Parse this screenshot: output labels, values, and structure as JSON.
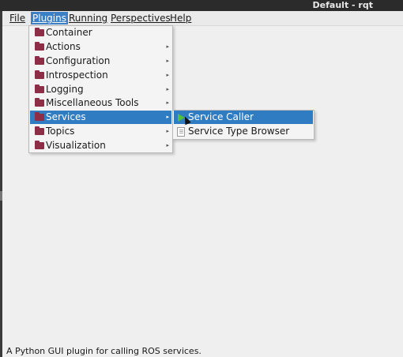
{
  "window": {
    "title": "Default - rqt"
  },
  "menubar": {
    "items": [
      {
        "label": "File"
      },
      {
        "label": "Plugins",
        "active": true
      },
      {
        "label": "Running"
      },
      {
        "label": "Perspectives"
      },
      {
        "label": "Help"
      }
    ]
  },
  "plugins_menu": {
    "items": [
      {
        "label": "Container",
        "has_submenu": false
      },
      {
        "label": "Actions",
        "has_submenu": true
      },
      {
        "label": "Configuration",
        "has_submenu": true
      },
      {
        "label": "Introspection",
        "has_submenu": true
      },
      {
        "label": "Logging",
        "has_submenu": true
      },
      {
        "label": "Miscellaneous Tools",
        "has_submenu": true
      },
      {
        "label": "Services",
        "has_submenu": true,
        "active": true
      },
      {
        "label": "Topics",
        "has_submenu": true
      },
      {
        "label": "Visualization",
        "has_submenu": true
      }
    ],
    "arrow": "▸"
  },
  "services_submenu": {
    "items": [
      {
        "label": "Service Caller",
        "icon": "play-icon",
        "active": true
      },
      {
        "label": "Service Type Browser",
        "icon": "document-icon"
      }
    ]
  },
  "statusbar": {
    "text": "A Python GUI plugin for calling ROS services."
  },
  "colors": {
    "highlight": "#2f7cc2",
    "folder_icon": "#8d2e46",
    "play_icon": "#4fc13a",
    "titlebar": "#2b2b2b"
  }
}
